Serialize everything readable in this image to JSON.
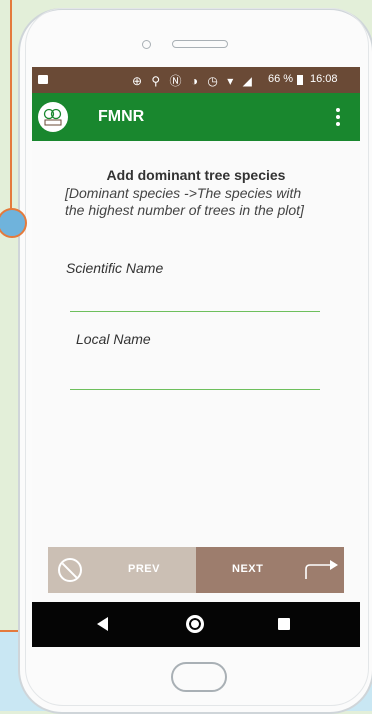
{
  "status_bar": {
    "battery": "66 %",
    "time": "16:08"
  },
  "app_bar": {
    "title": "FMNR"
  },
  "form": {
    "heading": "Add dominant tree species",
    "hint": "[Dominant species ->The species with the highest number of trees in the plot]",
    "scientific_name_label": "Scientific Name",
    "scientific_name_value": "",
    "local_name_label": "Local Name",
    "local_name_value": ""
  },
  "buttons": {
    "prev_label": "PREV",
    "next_label": "NEXT"
  },
  "icons": {
    "app_logo": "tree-logo-icon",
    "overflow": "more-vert-icon",
    "prev": "block-icon",
    "next": "arrow-forward-icon",
    "back": "back-triangle-icon",
    "home": "home-circle-icon",
    "recent": "recent-square-icon"
  },
  "colors": {
    "app_bar": "#19872e",
    "status_bar": "#6a4a36",
    "prev_button": "#cbbfb4",
    "next_button": "#9d7d6d",
    "input_underline": "#6dbf5c"
  }
}
